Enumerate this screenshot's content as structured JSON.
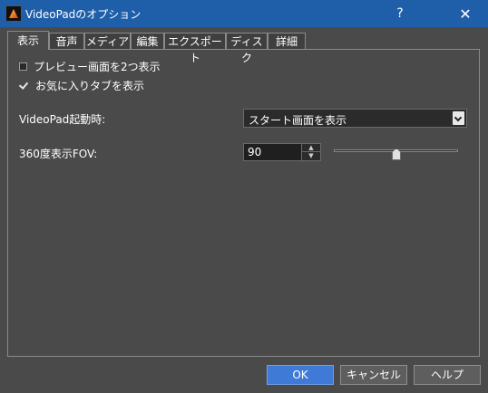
{
  "window": {
    "title": "VideoPadのオプション",
    "help_glyph": "?",
    "close_glyph": "✕"
  },
  "tabs": [
    {
      "label": "表示",
      "active": true
    },
    {
      "label": "音声"
    },
    {
      "label": "メディア"
    },
    {
      "label": "編集"
    },
    {
      "label": "エクスポート"
    },
    {
      "label": "ディスク"
    },
    {
      "label": "詳細"
    }
  ],
  "display": {
    "checkboxes": [
      {
        "label": "プレビュー画面を2つ表示",
        "checked": false
      },
      {
        "label": "お気に入りタブを表示",
        "checked": true
      }
    ],
    "startup_label": "VideoPad起動時:",
    "startup_value": "スタート画面を表示",
    "fov_label": "360度表示FOV:",
    "fov_value": "90",
    "fov_slider_fraction": 0.5
  },
  "buttons": {
    "ok": "OK",
    "cancel": "キャンセル",
    "help": "ヘルプ"
  },
  "colors": {
    "titlebar": "#1f5ea8",
    "background": "#4a4a4a",
    "primary_button": "#3f7bd6"
  }
}
